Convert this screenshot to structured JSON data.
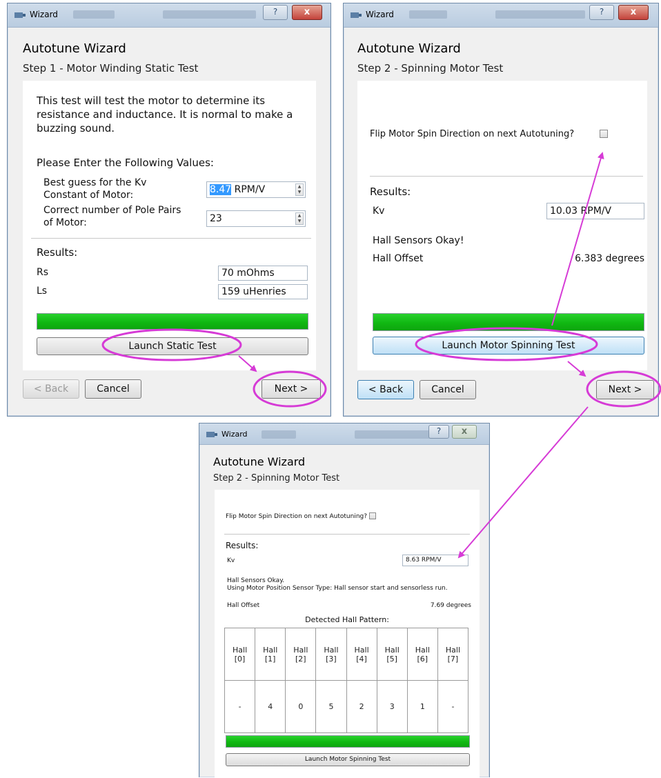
{
  "colors": {
    "annotation": "#d63bd6",
    "progress": "#14c016"
  },
  "icons": {
    "window_icon": "wizard-app-icon",
    "help": "help-icon",
    "close": "close-icon",
    "spin": "spin-up-down-icon"
  },
  "win1": {
    "title": "Wizard",
    "help": "?",
    "close": "x",
    "heading": "Autotune Wizard",
    "step": "Step 1 - Motor Winding Static Test",
    "description_line1": "This test will test the motor to determine its",
    "description_line2": "resistance and inductance. It is normal to make a",
    "description_line3": "buzzing sound.",
    "enter_values": "Please Enter the Following Values:",
    "kv_label_line1": "Best guess for the Kv",
    "kv_label_line2": "Constant of Motor:",
    "kv_value": "8.47",
    "kv_unit": "RPM/V",
    "pole_label_line1": "Correct number of Pole Pairs",
    "pole_label_line2": "of Motor:",
    "pole_value": "23",
    "results_label": "Results:",
    "rs_label": "Rs",
    "rs_value": "70 mOhms",
    "ls_label": "Ls",
    "ls_value": "159 uHenries",
    "progress": 1.0,
    "launch_button": "Launch Static Test",
    "back_button": "< Back",
    "cancel_button": "Cancel",
    "next_button": "Next >"
  },
  "win2": {
    "title": "Wizard",
    "help": "?",
    "close": "x",
    "heading": "Autotune Wizard",
    "step": "Step 2 - Spinning Motor Test",
    "flip_label": "Flip Motor Spin Direction on next Autotuning?",
    "flip_checked": false,
    "results_label": "Results:",
    "kv_label": "Kv",
    "kv_value": "10.03 RPM/V",
    "hall_status": "Hall Sensors Okay!",
    "hall_offset_label": "Hall Offset",
    "hall_offset_value": "6.383 degrees",
    "progress": 1.0,
    "launch_button": "Launch Motor Spinning Test",
    "back_button": "< Back",
    "cancel_button": "Cancel",
    "next_button": "Next >"
  },
  "win3": {
    "title": "Wizard",
    "help": "?",
    "close": "x",
    "heading": "Autotune Wizard",
    "step": "Step 2 - Spinning Motor Test",
    "flip_label": "Flip Motor Spin Direction on next Autotuning?",
    "flip_checked": false,
    "results_label": "Results:",
    "kv_label": "Kv",
    "kv_value": "8.63 RPM/V",
    "hall_status": "Hall Sensors Okay.",
    "sensor_type": "Using Motor Position Sensor Type: Hall sensor start and sensorless run.",
    "hall_offset_label": "Hall Offset",
    "hall_offset_value": "7.69 degrees",
    "pattern_title": "Detected Hall Pattern:",
    "hall_headers": [
      "Hall\n[0]",
      "Hall\n[1]",
      "Hall\n[2]",
      "Hall\n[3]",
      "Hall\n[4]",
      "Hall\n[5]",
      "Hall\n[6]",
      "Hall\n[7]"
    ],
    "hall_values": [
      "-",
      "4",
      "0",
      "5",
      "2",
      "3",
      "1",
      "-"
    ],
    "progress": 1.0,
    "launch_button": "Launch Motor Spinning Test"
  }
}
